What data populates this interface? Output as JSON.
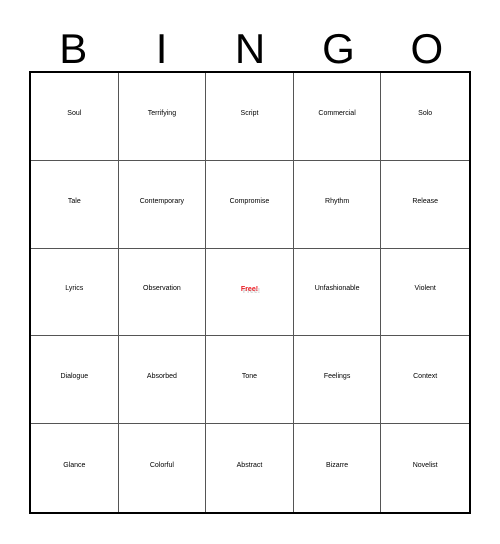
{
  "card": {
    "header_letters": [
      "B",
      "I",
      "N",
      "G",
      "O"
    ],
    "free_space_color": "#ED1C24",
    "free_space_shadow_color": "#cfcfcf",
    "border_color": "#000000",
    "gridline_color": "#555555",
    "rows": [
      [
        {
          "label": "Soul",
          "free": false
        },
        {
          "label": "Terrifying",
          "free": false
        },
        {
          "label": "Script",
          "free": false
        },
        {
          "label": "Commercial",
          "free": false
        },
        {
          "label": "Solo",
          "free": false
        }
      ],
      [
        {
          "label": "Tale",
          "free": false
        },
        {
          "label": "Contemporary",
          "free": false
        },
        {
          "label": "Compromise",
          "free": false
        },
        {
          "label": "Rhythm",
          "free": false
        },
        {
          "label": "Release",
          "free": false
        }
      ],
      [
        {
          "label": "Lyrics",
          "free": false
        },
        {
          "label": "Observation",
          "free": false
        },
        {
          "label": "Free!",
          "free": true
        },
        {
          "label": "Unfashionable",
          "free": false
        },
        {
          "label": "Violent",
          "free": false
        }
      ],
      [
        {
          "label": "Dialogue",
          "free": false
        },
        {
          "label": "Absorbed",
          "free": false
        },
        {
          "label": "Tone",
          "free": false
        },
        {
          "label": "Feelings",
          "free": false
        },
        {
          "label": "Context",
          "free": false
        }
      ],
      [
        {
          "label": "Glance",
          "free": false
        },
        {
          "label": "Colorful",
          "free": false
        },
        {
          "label": "Abstract",
          "free": false
        },
        {
          "label": "Bizarre",
          "free": false
        },
        {
          "label": "Novelist",
          "free": false
        }
      ]
    ]
  }
}
